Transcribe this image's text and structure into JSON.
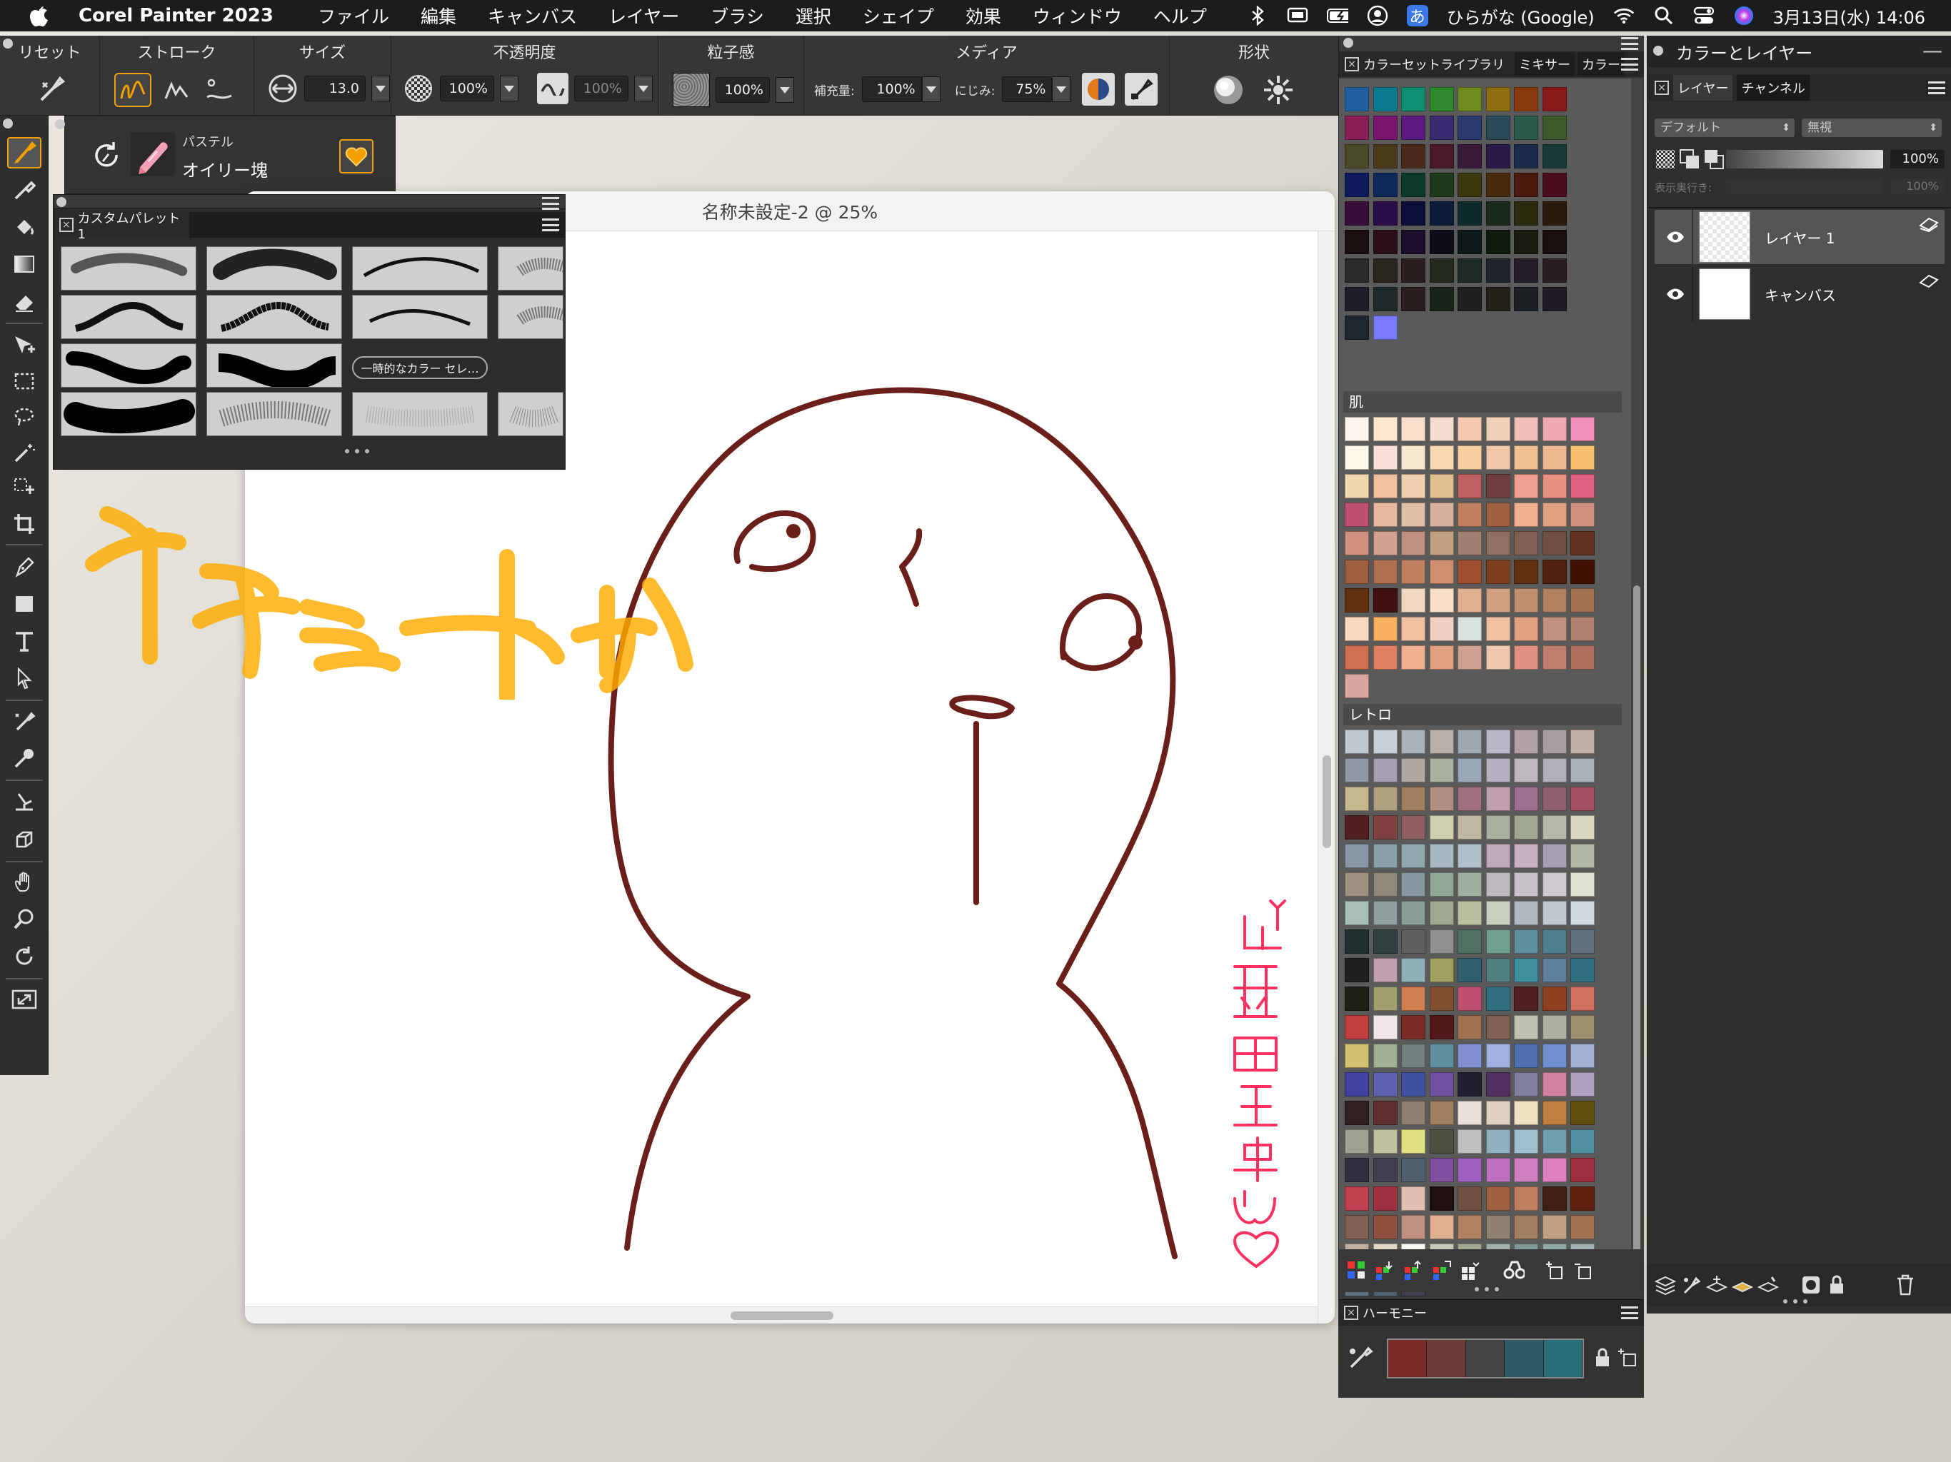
{
  "menubar": {
    "app_name": "Corel Painter 2023",
    "menus": [
      "ファイル",
      "編集",
      "キャンバス",
      "レイヤー",
      "ブラシ",
      "選択",
      "シェイプ",
      "効果",
      "ウィンドウ",
      "ヘルプ"
    ],
    "ime_char": "あ",
    "ime_label": "ひらがな (Google)",
    "datetime": "3月13日(水) 14:06"
  },
  "propbar": {
    "reset": "リセット",
    "stroke": "ストローク",
    "size": "サイズ",
    "size_value": "13.0",
    "opacity": "不透明度",
    "opacity_value": "100%",
    "opacity_value2": "100%",
    "grain": "粒子感",
    "grain_value": "100%",
    "media": "メディア",
    "resat_label": "補充量:",
    "resat_value": "100%",
    "bleed_label": "にじみ:",
    "bleed_value": "75%",
    "shape": "形状"
  },
  "brush": {
    "category": "パステル",
    "variant": "オイリー塊"
  },
  "palette": {
    "title": "カスタムパレット 1",
    "temp_color_btn": "一時的なカラー セレ…"
  },
  "canvas": {
    "title": "名称未設定-2 @ 25%"
  },
  "colorlib": {
    "title": "カラーセットライブラリ",
    "tab_mixer": "ミキサー",
    "tab_color": "カラー",
    "group_skin": "肌",
    "group_retro": "レトロ"
  },
  "layers": {
    "title": "カラーとレイヤー",
    "tab_layer": "レイヤー",
    "tab_channel": "チャンネル",
    "composite_method": "デフォルト",
    "composite_depth": "無視",
    "opacity_value": "100%",
    "depth_label": "表示奥行き:",
    "depth_value": "100%",
    "items": [
      {
        "name": "レイヤー 1"
      },
      {
        "name": "キャンバス"
      }
    ]
  },
  "harmony": {
    "title": "ハーモニー",
    "colors": [
      "#7a2b26",
      "#6e3b38",
      "#444444",
      "#2f5b64",
      "#286f7b"
    ]
  },
  "colors": {
    "menubar_bg": "#1c1c1e",
    "panel_bg": "#363636",
    "accent": "#f1a000",
    "stroke_brown": "#6b1f1a",
    "annotation_orange": "#ffab00",
    "annotation_red": "#ff3060"
  }
}
